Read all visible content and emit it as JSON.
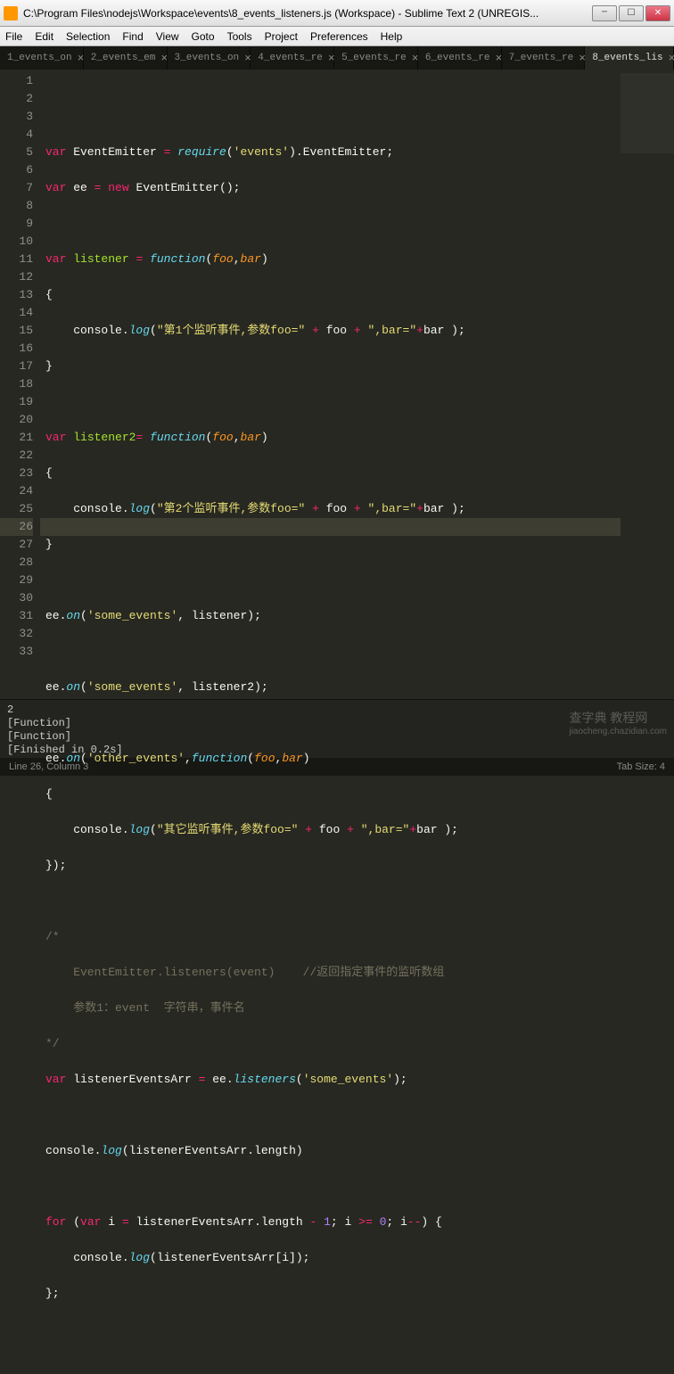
{
  "window": {
    "title": "C:\\Program Files\\nodejs\\Workspace\\events\\8_events_listeners.js (Workspace) - Sublime Text 2 (UNREGIS..."
  },
  "menu": [
    "File",
    "Edit",
    "Selection",
    "Find",
    "View",
    "Goto",
    "Tools",
    "Project",
    "Preferences",
    "Help"
  ],
  "tabs": [
    {
      "label": "1_events_on"
    },
    {
      "label": "2_events_em"
    },
    {
      "label": "3_events_on"
    },
    {
      "label": "4_events_re"
    },
    {
      "label": "5_events_re"
    },
    {
      "label": "6_events_re"
    },
    {
      "label": "7_events_re"
    },
    {
      "label": "8_events_lis"
    }
  ],
  "activeTab": 7,
  "lineNumbers": [
    "1",
    "2",
    "3",
    "4",
    "5",
    "6",
    "7",
    "8",
    "9",
    "10",
    "11",
    "12",
    "13",
    "14",
    "15",
    "16",
    "17",
    "18",
    "19",
    "20",
    "21",
    "22",
    "23",
    "24",
    "25",
    "26",
    "27",
    "28",
    "29",
    "30",
    "31",
    "32",
    "33"
  ],
  "activeLine": 26,
  "code": {
    "l1a": "var",
    "l1b": " EventEmitter ",
    "l1c": "=",
    "l1d": " require",
    "l1e": "(",
    "l1f": "'events'",
    "l1g": ").",
    "l1h": "EventEmitter",
    "l1i": ";",
    "l2a": "var",
    "l2b": " ee ",
    "l2c": "=",
    "l2d": " ",
    "l2e": "new",
    "l2f": " EventEmitter",
    "l2g": "();",
    "l4a": "var",
    "l4b": " ",
    "l4c": "listener",
    "l4d": " ",
    "l4e": "=",
    "l4f": " ",
    "l4g": "function",
    "l4h": "(",
    "l4i": "foo",
    "l4j": ",",
    "l4k": "bar",
    "l4l": ")",
    "l5": "{",
    "l6a": "    console.",
    "l6b": "log",
    "l6c": "(",
    "l6d": "\"第1个监听事件,参数foo=\"",
    "l6e": " ",
    "l6f": "+",
    "l6g": " foo ",
    "l6h": "+",
    "l6i": " ",
    "l6j": "\",bar=\"",
    "l6k": "+",
    "l6l": "bar );",
    "l7": "}",
    "l9a": "var",
    "l9b": " ",
    "l9c": "listener2",
    "l9d": "=",
    "l9e": " ",
    "l9f": "function",
    "l9g": "(",
    "l9h": "foo",
    "l9i": ",",
    "l9j": "bar",
    "l9k": ")",
    "l10": "{",
    "l11a": "    console.",
    "l11b": "log",
    "l11c": "(",
    "l11d": "\"第2个监听事件,参数foo=\"",
    "l11e": " ",
    "l11f": "+",
    "l11g": " foo ",
    "l11h": "+",
    "l11i": " ",
    "l11j": "\",bar=\"",
    "l11k": "+",
    "l11l": "bar );",
    "l12": "}",
    "l14a": "ee.",
    "l14b": "on",
    "l14c": "(",
    "l14d": "'some_events'",
    "l14e": ", listener);",
    "l16a": "ee.",
    "l16b": "on",
    "l16c": "(",
    "l16d": "'some_events'",
    "l16e": ", listener2);",
    "l18a": "ee.",
    "l18b": "on",
    "l18c": "(",
    "l18d": "'other_events'",
    "l18e": ",",
    "l18f": "function",
    "l18g": "(",
    "l18h": "foo",
    "l18i": ",",
    "l18j": "bar",
    "l18k": ")",
    "l19": "{",
    "l20a": "    console.",
    "l20b": "log",
    "l20c": "(",
    "l20d": "\"其它监听事件,参数foo=\"",
    "l20e": " ",
    "l20f": "+",
    "l20g": " foo ",
    "l20h": "+",
    "l20i": " ",
    "l20j": "\",bar=\"",
    "l20k": "+",
    "l20l": "bar );",
    "l21": "});",
    "l23": "/*",
    "l24": "    EventEmitter.listeners(event)    //返回指定事件的监听数组",
    "l25": "    参数1：event  字符串，事件名",
    "l26": "*/",
    "l27a": "var",
    "l27b": " listenerEventsArr ",
    "l27c": "=",
    "l27d": " ee.",
    "l27e": "listeners",
    "l27f": "(",
    "l27g": "'some_events'",
    "l27h": ");",
    "l29a": "console.",
    "l29b": "log",
    "l29c": "(listenerEventsArr.",
    "l29d": "length",
    "l29e": ")",
    "l31a": "for",
    "l31b": " (",
    "l31c": "var",
    "l31d": " i ",
    "l31e": "=",
    "l31f": " listenerEventsArr.length ",
    "l31g": "-",
    "l31h": " ",
    "l31i": "1",
    "l31j": "; i ",
    "l31k": ">=",
    "l31l": " ",
    "l31m": "0",
    "l31n": "; i",
    "l31o": "--",
    "l31p": ") {",
    "l32a": "    console.",
    "l32b": "log",
    "l32c": "(listenerEventsArr[i]);",
    "l33": "};"
  },
  "console": {
    "l1": "2",
    "l2": "[Function]",
    "l3": "[Function]",
    "l4": "[Finished in 0.2s]"
  },
  "status": {
    "left": "Line 26, Column 3",
    "right": "Tab Size: 4"
  },
  "watermark": {
    "main": "查字典",
    "sub": "jiaocheng.chazidian.com",
    "tag": "教程网"
  }
}
